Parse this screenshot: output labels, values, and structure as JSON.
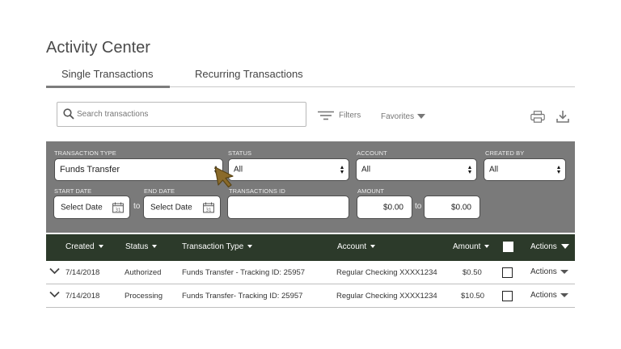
{
  "page": {
    "title": "Activity Center"
  },
  "tabs": [
    {
      "label": "Single Transactions",
      "active": true
    },
    {
      "label": "Recurring Transactions",
      "active": false
    }
  ],
  "search": {
    "placeholder": "Search transactions",
    "value": ""
  },
  "toolbar": {
    "filters_label": "Filters",
    "favorites_label": "Favorites",
    "print_icon": "printer-icon",
    "download_icon": "download-icon"
  },
  "filters": {
    "transaction_type": {
      "label": "TRANSACTION TYPE",
      "value": "Funds Transfer"
    },
    "status": {
      "label": "STATUS",
      "value": "All"
    },
    "account": {
      "label": "ACCOUNT",
      "value": "All"
    },
    "created_by": {
      "label": "CREATED BY",
      "value": "All"
    },
    "start_date": {
      "label": "START DATE",
      "value": "Select Date"
    },
    "end_date": {
      "label": "END DATE",
      "value": "Select Date"
    },
    "date_to": "to",
    "transactions_id": {
      "label": "TRANSACTIONS ID",
      "value": ""
    },
    "amount": {
      "label": "AMOUNT",
      "min": "$0.00",
      "max": "$0.00",
      "to": "to"
    }
  },
  "table": {
    "columns": {
      "created": "Created",
      "status": "Status",
      "transaction_type": "Transaction Type",
      "account": "Account",
      "amount": "Amount",
      "actions": "Actions"
    },
    "rows": [
      {
        "created": "7/14/2018",
        "status": "Authorized",
        "transaction_type": "Funds Transfer - Tracking ID: 25957",
        "account": "Regular Checking XXXX1234",
        "amount": "$0.50",
        "actions": "Actions"
      },
      {
        "created": "7/14/2018",
        "status": "Processing",
        "transaction_type": "Funds Transfer- Tracking ID: 25957",
        "account": "Regular Checking XXXX1234",
        "amount": "$10.50",
        "actions": "Actions"
      }
    ]
  },
  "colors": {
    "panel": "#7a7a7a",
    "table_header": "#2c3a2a",
    "cursor": "#8a6a2a"
  }
}
